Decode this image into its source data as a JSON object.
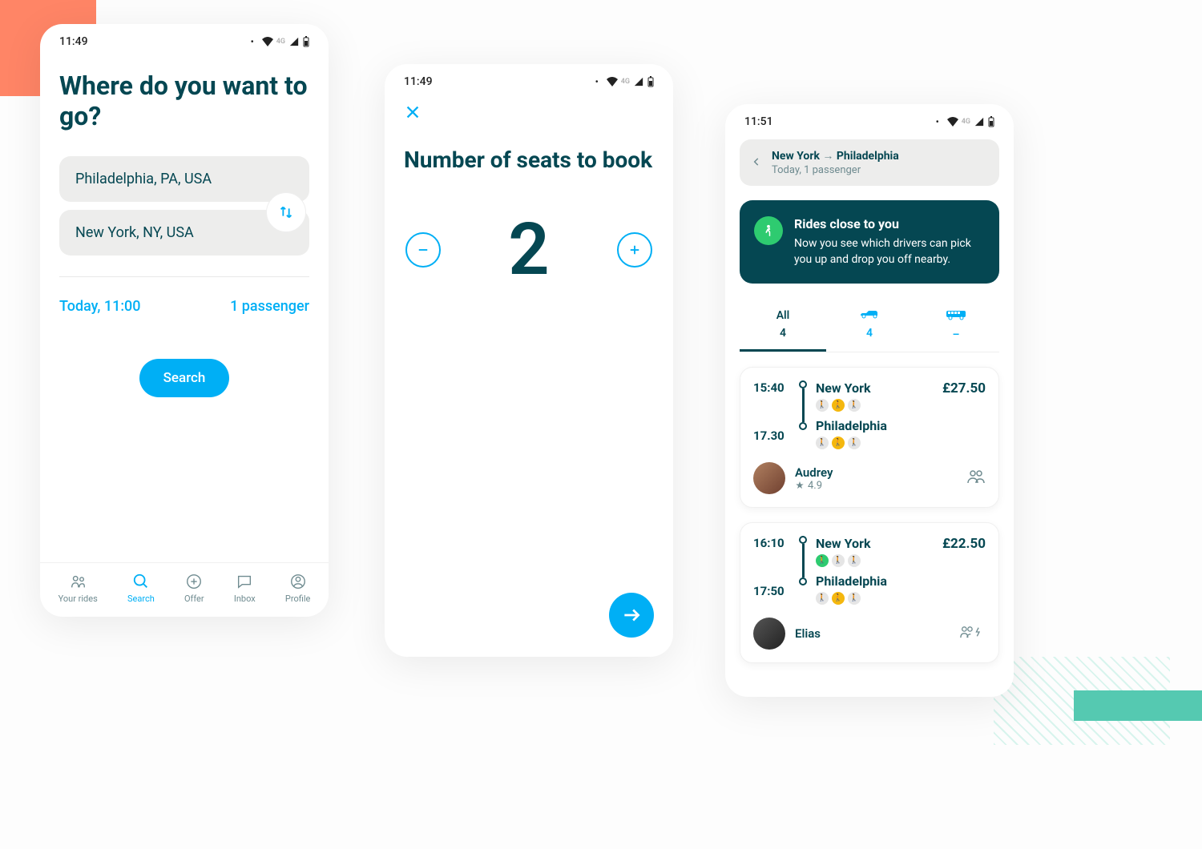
{
  "status": {
    "time1": "11:49",
    "time2": "11:49",
    "time3": "11:51",
    "network": "4G"
  },
  "screen1": {
    "title": "Where do you want to go?",
    "from": "Philadelphia, PA, USA",
    "to": "New York, NY, USA",
    "datetime": "Today, 11:00",
    "passengers": "1 passenger",
    "search_label": "Search",
    "nav": {
      "your_rides": "Your rides",
      "search": "Search",
      "offer": "Offer",
      "inbox": "Inbox",
      "profile": "Profile"
    }
  },
  "screen2": {
    "title": "Number of seats to book",
    "seats": "2"
  },
  "screen3": {
    "route_from": "New York",
    "route_to": "Philadelphia",
    "summary_sub": "Today, 1 passenger",
    "info_title": "Rides close to you",
    "info_text": "Now you see which drivers can pick you up and drop you off nearby.",
    "tabs": {
      "all_label": "All",
      "all_count": "4",
      "car_count": "4",
      "bus_count": "–"
    },
    "rides": [
      {
        "dep_time": "15:40",
        "dep_city": "New York",
        "arr_time": "17.30",
        "arr_city": "Philadelphia",
        "price": "£27.50",
        "driver": "Audrey",
        "rating": "4.9"
      },
      {
        "dep_time": "16:10",
        "dep_city": "New York",
        "arr_time": "17:50",
        "arr_city": "Philadelphia",
        "price": "£22.50",
        "driver": "Elias",
        "rating": ""
      }
    ]
  }
}
